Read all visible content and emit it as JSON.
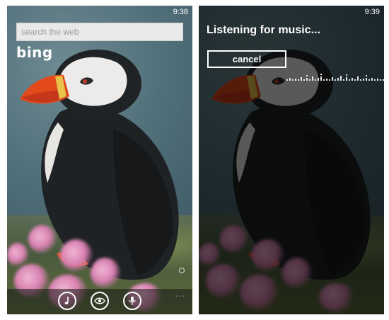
{
  "screens": {
    "left": {
      "status_time": "9:38",
      "search": {
        "placeholder": "search the web"
      },
      "logo": "bing",
      "app_bar": {
        "buttons": [
          {
            "name": "music-button",
            "icon": "music-note-icon"
          },
          {
            "name": "vision-button",
            "icon": "eye-icon"
          },
          {
            "name": "voice-button",
            "icon": "microphone-icon"
          }
        ],
        "more": "..."
      }
    },
    "right": {
      "status_time": "9:39",
      "title": "Listening for music...",
      "cancel_label": "cancel"
    }
  }
}
